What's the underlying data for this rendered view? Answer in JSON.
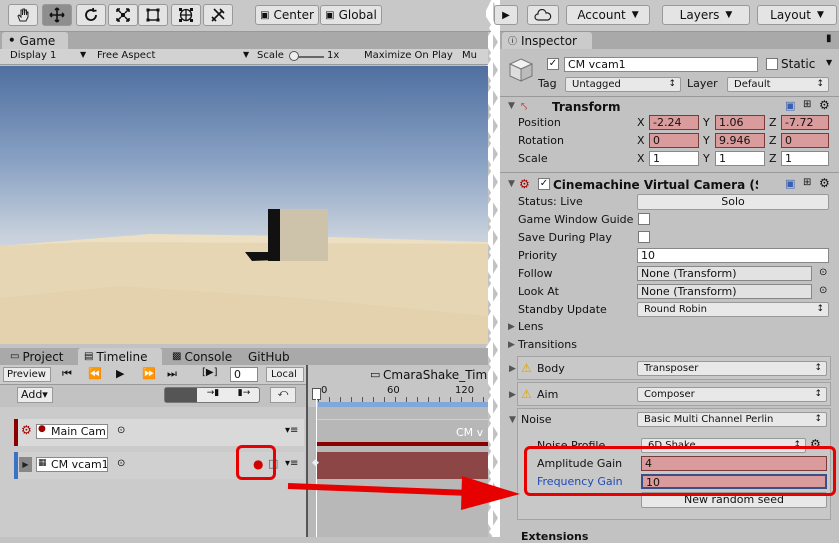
{
  "toolbar": {
    "tools": [
      "hand-icon",
      "move-icon",
      "rotate-icon",
      "scale-icon",
      "rect-icon",
      "transform-icon",
      "custom-tool-icon"
    ],
    "pivot_label": "Center",
    "space_label": "Global",
    "collab_label": "▶",
    "account_label": "Account",
    "layers_label": "Layers",
    "layout_label": "Layout"
  },
  "game": {
    "tab_label": "Game",
    "display": "Display 1",
    "aspect": "Free Aspect",
    "scale_label": "Scale",
    "scale_value": "1x",
    "maximize": "Maximize On Play",
    "mute": "Mu"
  },
  "timeline": {
    "tabs": [
      "Project",
      "Timeline",
      "Console",
      "GitHub"
    ],
    "preview": "Preview",
    "frame": "0",
    "local": "Local",
    "add": "Add▾",
    "asset_name": "CmaraShake_Tim",
    "ruler": [
      "0",
      "60",
      "120"
    ],
    "tracks": [
      {
        "label": "Main Cam",
        "clip": "CM v"
      },
      {
        "label": "CM vcam1",
        "clip": ""
      }
    ]
  },
  "inspector": {
    "tab_label": "Inspector",
    "object_name": "CM vcam1",
    "static_label": "Static",
    "tag_label": "Tag",
    "tag_value": "Untagged",
    "layer_label": "Layer",
    "layer_value": "Default",
    "transform": {
      "title": "Transform",
      "rows": [
        {
          "label": "Position",
          "x": "-2.24",
          "y": "1.06",
          "z": "-7.72"
        },
        {
          "label": "Rotation",
          "x": "0",
          "y": "9.946",
          "z": "0"
        },
        {
          "label": "Scale",
          "x": "1",
          "y": "1",
          "z": "1"
        }
      ]
    },
    "vcam": {
      "title": "Cinemachine Virtual Camera (Sc",
      "status_label": "Status: Live",
      "solo_label": "Solo",
      "game_window_guides": "Game Window Guide",
      "save_during_play": "Save During Play",
      "priority_label": "Priority",
      "priority_value": "10",
      "follow_label": "Follow",
      "follow_value": "None (Transform)",
      "lookat_label": "Look At",
      "lookat_value": "None (Transform)",
      "standby_label": "Standby Update",
      "standby_value": "Round Robin",
      "lens_label": "Lens",
      "transitions_label": "Transitions",
      "body_label": "Body",
      "body_value": "Transposer",
      "aim_label": "Aim",
      "aim_value": "Composer",
      "noise_label": "Noise",
      "noise_value": "Basic Multi Channel Perlin",
      "noise_profile_label": "Noise Profile",
      "noise_profile_value": "6D Shake",
      "amplitude_label": "Amplitude Gain",
      "amplitude_value": "4",
      "frequency_label": "Frequency Gain",
      "frequency_value": "10",
      "random_seed_label": "New random seed",
      "extensions_label": "Extensions"
    }
  },
  "colors": {
    "accent_red": "#e60000",
    "record_red": "#d40000",
    "selection_blue": "#3a72c4",
    "field_red": "#d99b9b"
  }
}
